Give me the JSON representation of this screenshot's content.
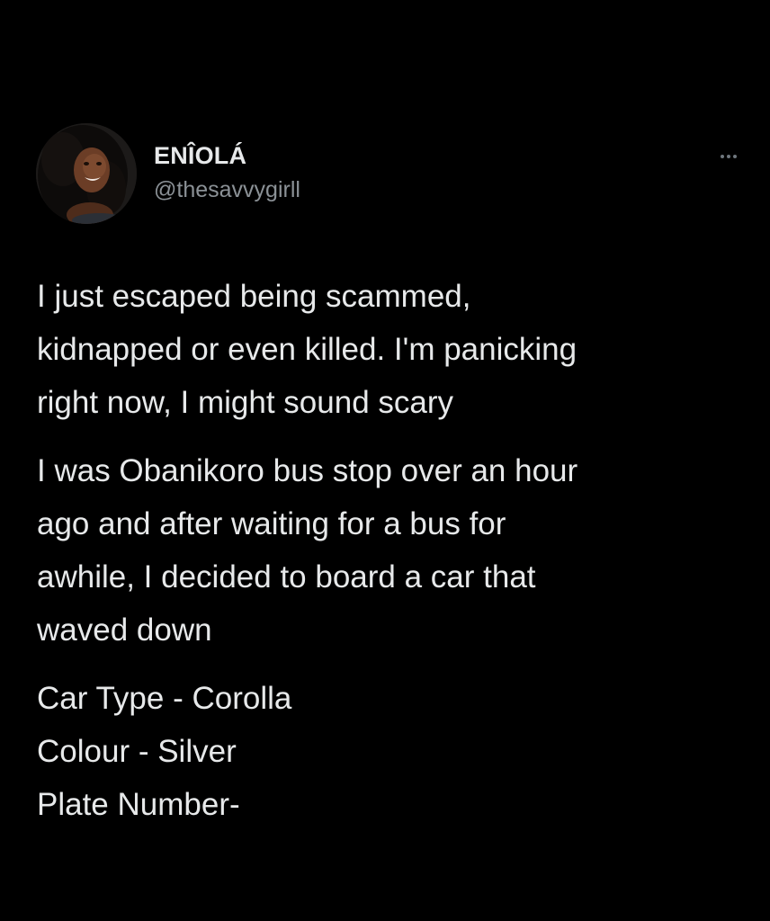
{
  "tweet": {
    "author": {
      "display_name": "ENÎOLÁ",
      "handle": "@thesavvygirll",
      "avatar_icon": "profile-photo"
    },
    "more_icon": "more-horizontal-icon",
    "paragraphs": [
      "I just escaped being scammed,\nkidnapped or even killed. I'm panicking\nright now, I might sound scary",
      "I was Obanikoro bus stop over an hour\nago and after waiting for a bus for\nawhile, I decided to board a car that\nwaved down",
      "Car Type - Corolla\nColour - Silver\nPlate Number-"
    ]
  },
  "colors": {
    "background": "#000000",
    "primary_text": "#e7e9ea",
    "secondary_text": "#8b9196"
  }
}
